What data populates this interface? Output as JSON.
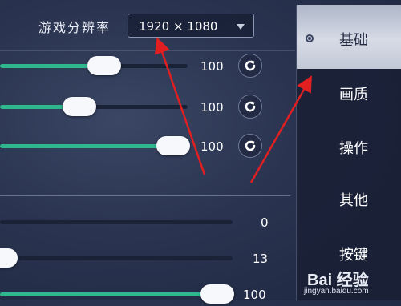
{
  "resolution": {
    "label": "游戏分辨率",
    "value": "1920 × 1080"
  },
  "sliders_top": [
    {
      "value": "100",
      "level": 0.55
    },
    {
      "value": "100",
      "level": 0.42
    },
    {
      "value": "100",
      "level": 0.92
    }
  ],
  "sliders_bottom": [
    {
      "value": "0",
      "level": null
    },
    {
      "value": "13",
      "level": 0.0
    },
    {
      "value": "100",
      "level": 0.93
    }
  ],
  "sidebar": {
    "tabs": [
      {
        "label": "基础",
        "active": true
      },
      {
        "label": "画质",
        "active": false
      },
      {
        "label": "操作",
        "active": false
      },
      {
        "label": "其他",
        "active": false
      },
      {
        "label": "按键",
        "active": false
      }
    ]
  },
  "watermark": {
    "logo": "Bai 经验",
    "url": "jingyan.baidu.com"
  },
  "colors": {
    "accent_track": "#2fb88e",
    "annotation_arrow": "#e02020",
    "active_tab": "#d6dbe6"
  }
}
